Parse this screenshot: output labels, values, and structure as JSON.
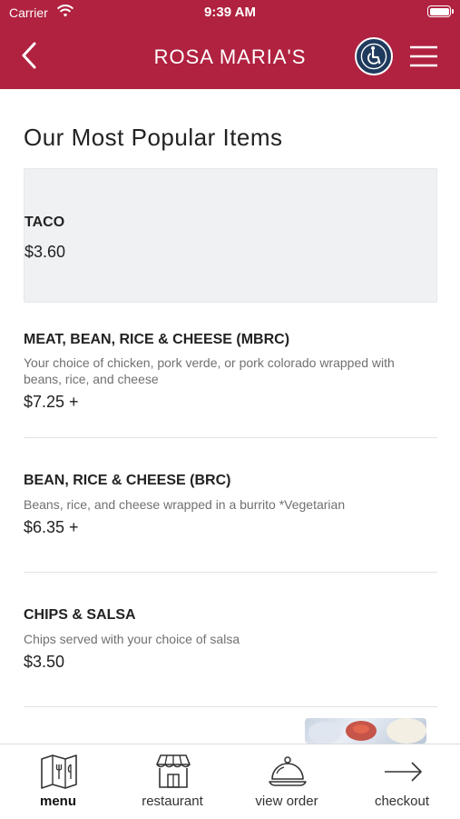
{
  "status_bar": {
    "carrier": "Carrier",
    "time": "9:39 AM"
  },
  "header": {
    "title": "ROSA MARIA'S",
    "brand_color": "#b02240"
  },
  "section": {
    "title": "Our Most Popular Items"
  },
  "items": [
    {
      "name": "TACO",
      "description": "",
      "price": "$3.60"
    },
    {
      "name": "MEAT, BEAN, RICE & CHEESE (MBRC)",
      "description": "Your choice of chicken, pork verde, or pork colorado wrapped with beans, rice, and cheese",
      "price": "$7.25 +"
    },
    {
      "name": "BEAN, RICE & CHEESE (BRC)",
      "description": "Beans, rice, and cheese wrapped in a burrito *Vegetarian",
      "price": "$6.35 +"
    },
    {
      "name": "CHIPS & SALSA",
      "description": "Chips served with your choice of salsa",
      "price": "$3.50"
    }
  ],
  "tabbar": {
    "tabs": [
      {
        "label": "menu",
        "icon": "menu-book-icon",
        "active": true
      },
      {
        "label": "restaurant",
        "icon": "storefront-icon",
        "active": false
      },
      {
        "label": "view order",
        "icon": "cloche-icon",
        "active": false
      },
      {
        "label": "checkout",
        "icon": "arrow-right-icon",
        "active": false
      }
    ]
  }
}
